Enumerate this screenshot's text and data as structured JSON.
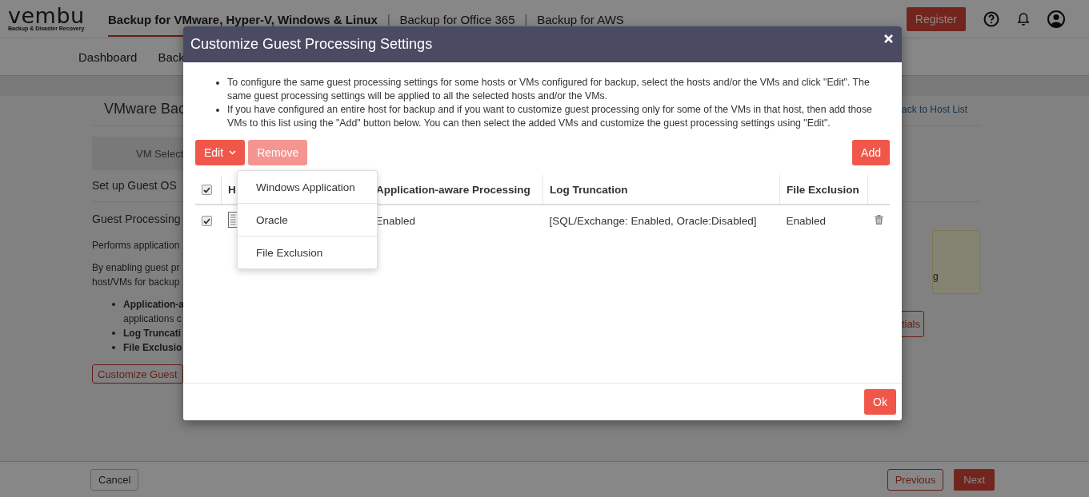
{
  "app_header": {
    "logo": "vembu",
    "logo_tagline": "Backup & Disaster Recovery",
    "product_tabs": [
      {
        "label": "Backup for VMware, Hyper-V, Windows & Linux",
        "selected": true
      },
      {
        "label": "Backup for Office 365",
        "selected": false
      },
      {
        "label": "Backup for AWS",
        "selected": false
      }
    ],
    "separator": "|",
    "register_button": "Register"
  },
  "nav": {
    "items": [
      "Dashboard",
      "Back"
    ]
  },
  "page": {
    "title": "VMware Bac",
    "back_link": "ack to Host List",
    "step_tab": "VM Select",
    "section_1": "Set up Guest OS",
    "section_2": "Guest Processing",
    "description_1": "Performs application",
    "description_2": [
      "By enabling guest pr",
      "host/VMs for backup"
    ],
    "features": [
      {
        "name": "Application-a",
        "detail": "applications c"
      },
      {
        "name": "Log Truncati"
      },
      {
        "name": "File Exclusio"
      }
    ],
    "note_text": "g",
    "customize_button": "Customize Guest",
    "credentials_button": "tials"
  },
  "footer": {
    "cancel": "Cancel",
    "previous": "Previous",
    "next": "Next"
  },
  "modal": {
    "title": "Customize Guest Processing Settings",
    "info": [
      "To configure the same guest processing settings for some hosts or VMs configured for backup, select the hosts and/or the VMs and click \"Edit\". The same guest processing settings will be applied to all the selected hosts and/or the VMs.",
      "If you have configured an entire host for backup and if you want to customize guest processing only for some of the VMs in that host, then add those VMs to this list using the \"Add\" button below. You can then select the added VMs and customize the guest processing settings using \"Edit\"."
    ],
    "edit_button": "Edit",
    "remove_button": {
      "label": "Remove",
      "disabled": true
    },
    "add_button": "Add",
    "select_all": {
      "checked": true
    },
    "columns": [
      "H",
      "Application-aware Processing",
      "Log Truncation",
      "File Exclusion"
    ],
    "rows": [
      {
        "checked": true,
        "application_aware": "Enabled",
        "log_truncation": "[SQL/Exchange: Enabled, Oracle:Disabled]",
        "file_exclusion": "Enabled"
      }
    ],
    "edit_menu": [
      "Windows Application",
      "Oracle",
      "File Exclusion"
    ],
    "ok_button": "Ok"
  }
}
